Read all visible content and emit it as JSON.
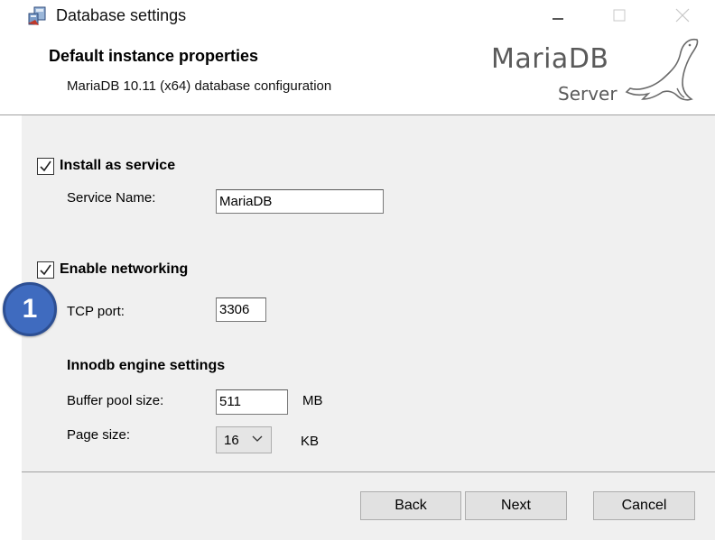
{
  "window": {
    "title": "Database settings"
  },
  "header": {
    "title": "Default instance properties",
    "subtitle": "MariaDB 10.11 (x64) database configuration",
    "logo_text": "MariaDB",
    "logo_sub": "Server"
  },
  "form": {
    "install_service": {
      "label": "Install as service",
      "checked": true
    },
    "service_name": {
      "label": "Service Name:",
      "value": "MariaDB"
    },
    "enable_networking": {
      "label": "Enable networking",
      "checked": true
    },
    "tcp_port": {
      "label": "TCP port:",
      "value": "3306"
    },
    "innodb": {
      "heading": "Innodb engine settings",
      "buffer_pool": {
        "label": "Buffer pool size:",
        "value": "511",
        "unit": "MB"
      },
      "page_size": {
        "label": "Page size:",
        "value": "16",
        "unit": "KB"
      }
    }
  },
  "buttons": {
    "back": "Back",
    "next": "Next",
    "cancel": "Cancel"
  },
  "annotation": {
    "badge": "1",
    "color": "#3f6bbf"
  }
}
